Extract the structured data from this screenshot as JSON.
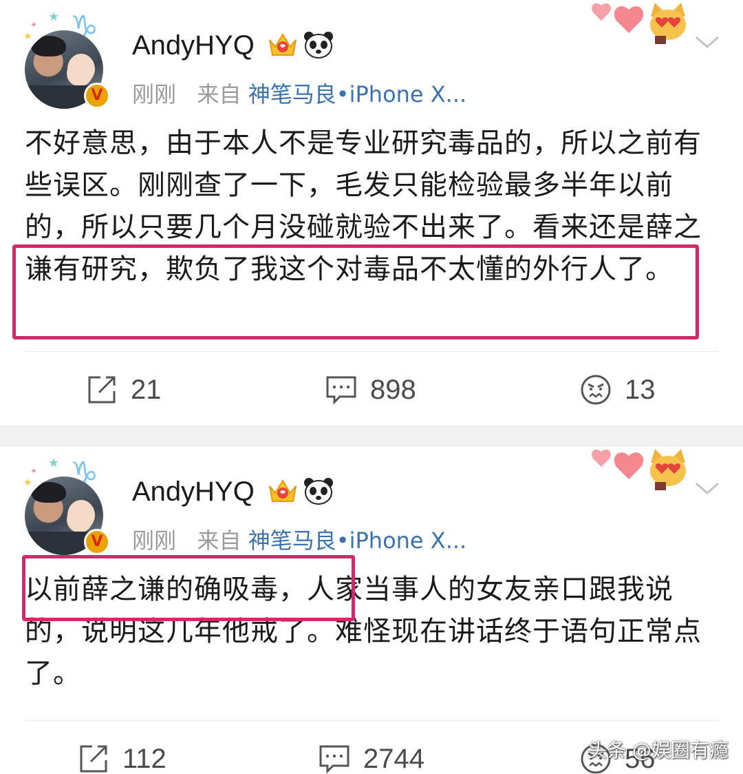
{
  "posts": [
    {
      "username": "AndyHYQ",
      "time": "刚刚",
      "from_label": "来自",
      "source": "神笔马良•iPhone X...",
      "verified_glyph": "V",
      "body": "不好意思，由于本人不是专业研究毒品的，所以之前有些误区。刚刚查了一下，毛发只能检验最多半年以前的，所以只要几个月没碰就验不出来了。看来还是薛之谦有研究，欺负了我这个对毒品不太懂的外行人了。",
      "actions": {
        "repost": "21",
        "comment": "898",
        "like": "13"
      }
    },
    {
      "username": "AndyHYQ",
      "time": "刚刚",
      "from_label": "来自",
      "source": "神笔马良•iPhone X...",
      "verified_glyph": "V",
      "body": "以前薛之谦的确吸毒，人家当事人的女友亲口跟我说的，说明这几年他戒了。难怪现在讲话终于语句正常点了。",
      "actions": {
        "repost": "112",
        "comment": "2744",
        "like": "56"
      }
    }
  ],
  "watermark": "头条 @娱圈有瘾",
  "colors": {
    "highlight": "#d12a6b",
    "link": "#3a72b0",
    "meta": "#9a9a9a"
  },
  "icons": [
    "capricorn-icon",
    "crown-badge-icon",
    "panda-badge-icon",
    "hearts-icon",
    "cat-emoji-icon",
    "chevron-down-icon",
    "repost-icon",
    "comment-icon",
    "like-icon"
  ]
}
